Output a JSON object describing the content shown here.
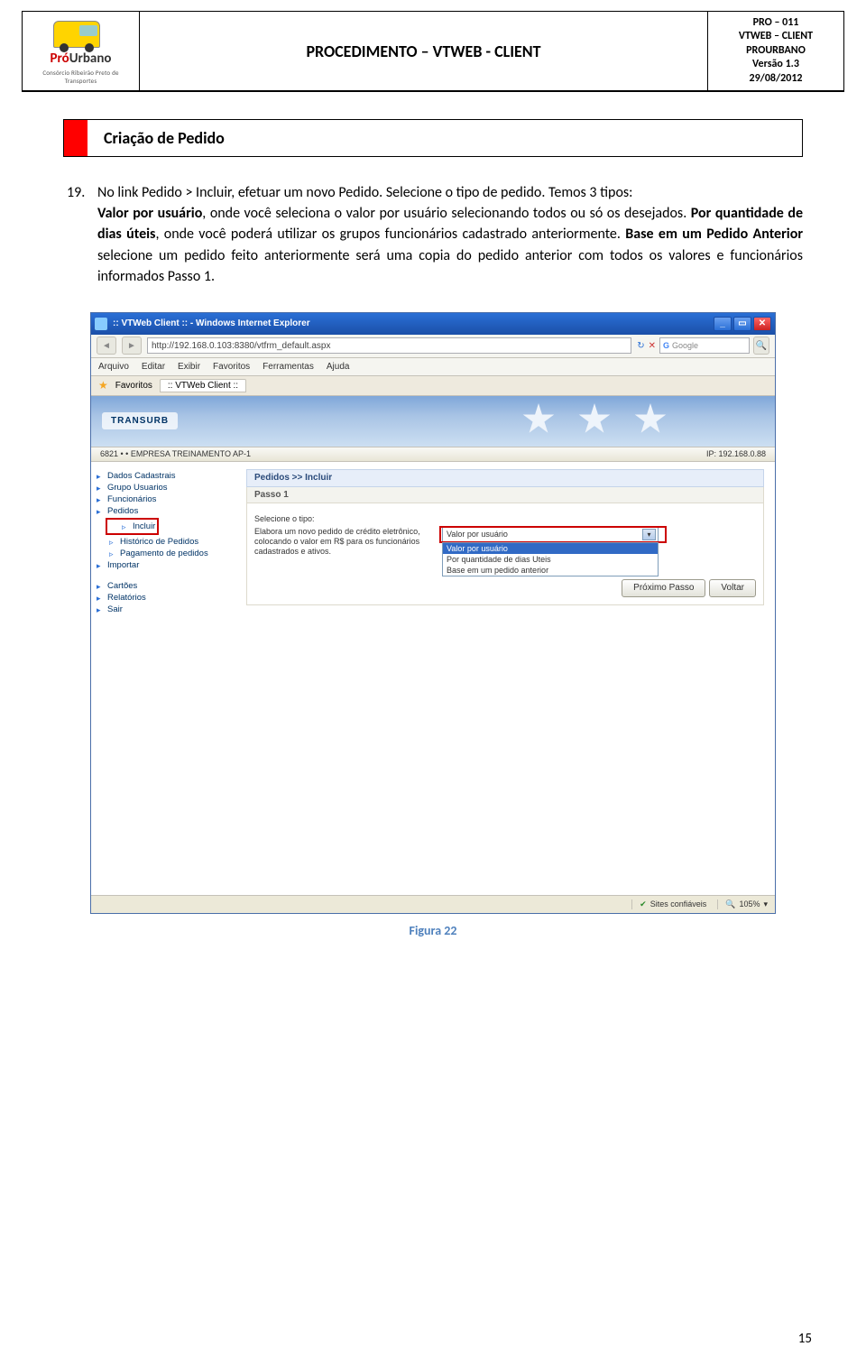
{
  "header": {
    "title": "PROCEDIMENTO – VTWEB - CLIENT",
    "logo_text_1": "Pró",
    "logo_text_2": "Urbano",
    "logo_sub": "Consórcio Ribeirão Preto de Transportes",
    "meta": {
      "l1": "PRO – 011",
      "l2": "VTWEB – CLIENT",
      "l3": "PROURBANO",
      "l4": "Versão 1.3",
      "l5": "29/08/2012"
    }
  },
  "section": {
    "title": "Criação de Pedido"
  },
  "item": {
    "num": "19.",
    "part1": "No link Pedido > Incluir, efetuar um novo Pedido. Selecione o tipo de pedido. Temos 3 tipos:",
    "b1": "Valor por usuário",
    "t1": ", onde você seleciona o valor por usuário selecionando todos ou só os desejados. ",
    "b2": "Por quantidade de dias úteis",
    "t2": ", onde você poderá utilizar os grupos funcionários cadastrado anteriormente. ",
    "b3": "Base em um Pedido Anterior",
    "t3": " selecione um pedido feito anteriormente será uma copia do pedido anterior com todos os valores e funcionários informados Passo 1."
  },
  "shot": {
    "window_title": ":: VTWeb Client :: - Windows Internet Explorer",
    "url": "http://192.168.0.103:8380/vtfrm_default.aspx",
    "search_engine": "Google",
    "menus": [
      "Arquivo",
      "Editar",
      "Exibir",
      "Favoritos",
      "Ferramentas",
      "Ajuda"
    ],
    "fav_label": "Favoritos",
    "tab_label": ":: VTWeb Client ::",
    "banner_logo": "TRANSURB",
    "info_left": "6821  •  • EMPRESA TREINAMENTO AP-1",
    "info_right": "IP: 192.168.0.88",
    "sidebar": {
      "i1": "Dados Cadastrais",
      "i2": "Grupo Usuarios",
      "i3": "Funcionários",
      "i4": "Pedidos",
      "i4a": "Incluir",
      "i4b": "Histórico de Pedidos",
      "i4c": "Pagamento de pedidos",
      "i5": "Importar",
      "i6": "Cartões",
      "i7": "Relatórios",
      "i8": "Sair"
    },
    "pane": {
      "title": "Pedidos  >>  Incluir",
      "step": "Passo 1",
      "label": "Selecione o tipo:",
      "desc": "Elabora um novo pedido de crédito eletrônico, colocando o valor em R$ para os funcionários cadastrados e ativos.",
      "select_value": "Valor por usuário",
      "dd1": "Valor por usuário",
      "dd2": "Por quantidade de dias Uteis",
      "dd3": "Base em um pedido anterior",
      "btn_next": "Próximo Passo",
      "btn_back": "Voltar"
    },
    "status": {
      "trusted": "Sites confiáveis",
      "zoom": "105%"
    }
  },
  "caption": "Figura 22",
  "page_number": "15"
}
